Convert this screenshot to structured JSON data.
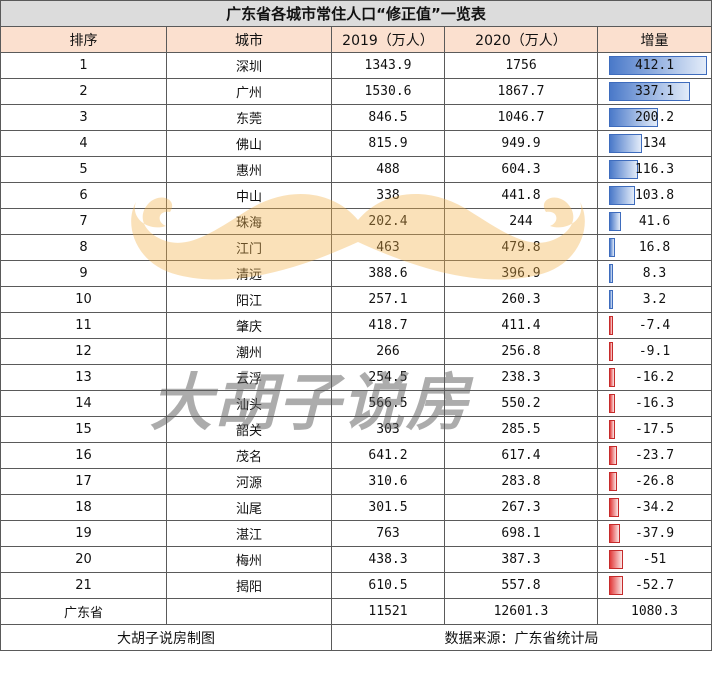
{
  "table": {
    "title": "广东省各城市常住人口“修正值”一览表",
    "headers": {
      "rank": "排序",
      "city": "城市",
      "pop2019": "2019（万人）",
      "pop2020": "2020（万人）",
      "delta": "增量"
    },
    "rows": [
      {
        "rank": "1",
        "city": "深圳",
        "pop2019": "1343.9",
        "pop2020": "1756",
        "delta": "412.1",
        "delta_value": 412.1
      },
      {
        "rank": "2",
        "city": "广州",
        "pop2019": "1530.6",
        "pop2020": "1867.7",
        "delta": "337.1",
        "delta_value": 337.1
      },
      {
        "rank": "3",
        "city": "东莞",
        "pop2019": "846.5",
        "pop2020": "1046.7",
        "delta": "200.2",
        "delta_value": 200.2
      },
      {
        "rank": "4",
        "city": "佛山",
        "pop2019": "815.9",
        "pop2020": "949.9",
        "delta": "134",
        "delta_value": 134
      },
      {
        "rank": "5",
        "city": "惠州",
        "pop2019": "488",
        "pop2020": "604.3",
        "delta": "116.3",
        "delta_value": 116.3
      },
      {
        "rank": "6",
        "city": "中山",
        "pop2019": "338",
        "pop2020": "441.8",
        "delta": "103.8",
        "delta_value": 103.8
      },
      {
        "rank": "7",
        "city": "珠海",
        "pop2019": "202.4",
        "pop2020": "244",
        "delta": "41.6",
        "delta_value": 41.6
      },
      {
        "rank": "8",
        "city": "江门",
        "pop2019": "463",
        "pop2020": "479.8",
        "delta": "16.8",
        "delta_value": 16.8
      },
      {
        "rank": "9",
        "city": "清远",
        "pop2019": "388.6",
        "pop2020": "396.9",
        "delta": "8.3",
        "delta_value": 8.3
      },
      {
        "rank": "10",
        "city": "阳江",
        "pop2019": "257.1",
        "pop2020": "260.3",
        "delta": "3.2",
        "delta_value": 3.2
      },
      {
        "rank": "11",
        "city": "肇庆",
        "pop2019": "418.7",
        "pop2020": "411.4",
        "delta": "-7.4",
        "delta_value": -7.4
      },
      {
        "rank": "12",
        "city": "潮州",
        "pop2019": "266",
        "pop2020": "256.8",
        "delta": "-9.1",
        "delta_value": -9.1
      },
      {
        "rank": "13",
        "city": "云浮",
        "pop2019": "254.5",
        "pop2020": "238.3",
        "delta": "-16.2",
        "delta_value": -16.2
      },
      {
        "rank": "14",
        "city": "汕头",
        "pop2019": "566.5",
        "pop2020": "550.2",
        "delta": "-16.3",
        "delta_value": -16.3
      },
      {
        "rank": "15",
        "city": "韶关",
        "pop2019": "303",
        "pop2020": "285.5",
        "delta": "-17.5",
        "delta_value": -17.5
      },
      {
        "rank": "16",
        "city": "茂名",
        "pop2019": "641.2",
        "pop2020": "617.4",
        "delta": "-23.7",
        "delta_value": -23.7
      },
      {
        "rank": "17",
        "city": "河源",
        "pop2019": "310.6",
        "pop2020": "283.8",
        "delta": "-26.8",
        "delta_value": -26.8
      },
      {
        "rank": "18",
        "city": "汕尾",
        "pop2019": "301.5",
        "pop2020": "267.3",
        "delta": "-34.2",
        "delta_value": -34.2
      },
      {
        "rank": "19",
        "city": "湛江",
        "pop2019": "763",
        "pop2020": "698.1",
        "delta": "-37.9",
        "delta_value": -37.9
      },
      {
        "rank": "20",
        "city": "梅州",
        "pop2019": "438.3",
        "pop2020": "387.3",
        "delta": "-51",
        "delta_value": -51
      },
      {
        "rank": "21",
        "city": "揭阳",
        "pop2019": "610.5",
        "pop2020": "557.8",
        "delta": "-52.7",
        "delta_value": -52.7
      }
    ],
    "total": {
      "label": "广东省",
      "pop2019": "11521",
      "pop2020": "12601.3",
      "delta": "1080.3"
    },
    "footer": {
      "maker": "大胡子说房制图",
      "source": "数据来源：广东省统计局"
    },
    "bar_colors": {
      "positive": "#4a79c9",
      "negative": "#e23b3b"
    }
  },
  "watermark": {
    "text": "大胡子说房",
    "mustache_color": "#f2b24a",
    "icon": "mustache-icon"
  }
}
